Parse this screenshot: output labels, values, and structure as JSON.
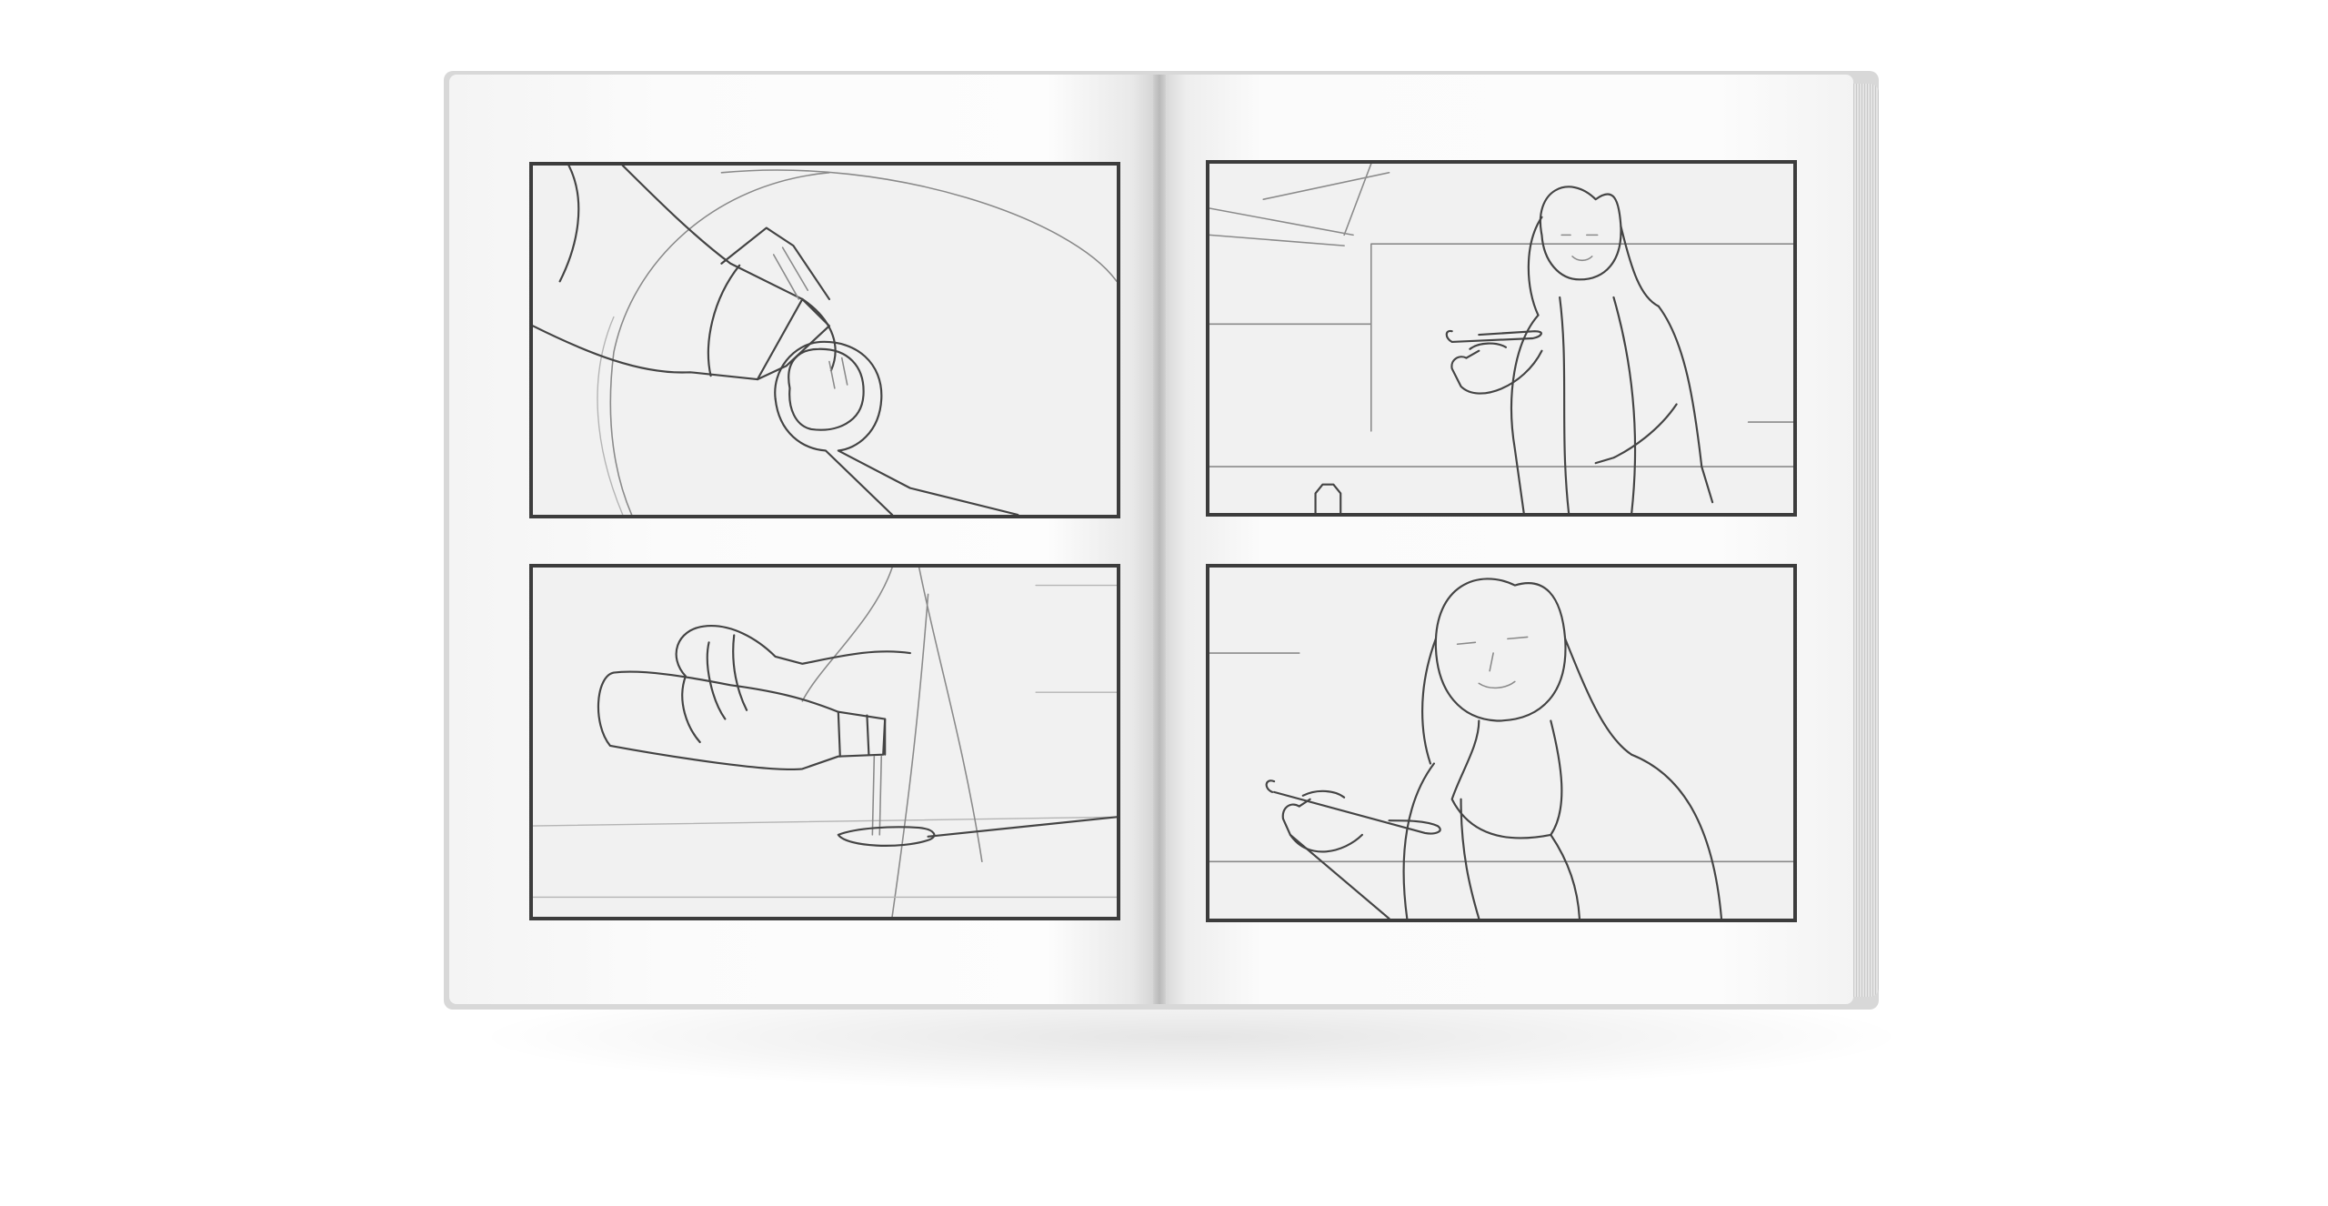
{
  "scene": {
    "object": "open-sketchbook",
    "background_color": "#ffffff",
    "page_color": "#fafafa",
    "panel_border_color": "#3c3c3c"
  },
  "panels": [
    {
      "id": 1,
      "icon": "pour-into-spoon-closeup-sketch"
    },
    {
      "id": 2,
      "icon": "hand-pouring-bottle-sketch"
    },
    {
      "id": 3,
      "icon": "woman-holding-spoon-wide-sketch"
    },
    {
      "id": 4,
      "icon": "woman-holding-spoon-closeup-sketch"
    }
  ]
}
